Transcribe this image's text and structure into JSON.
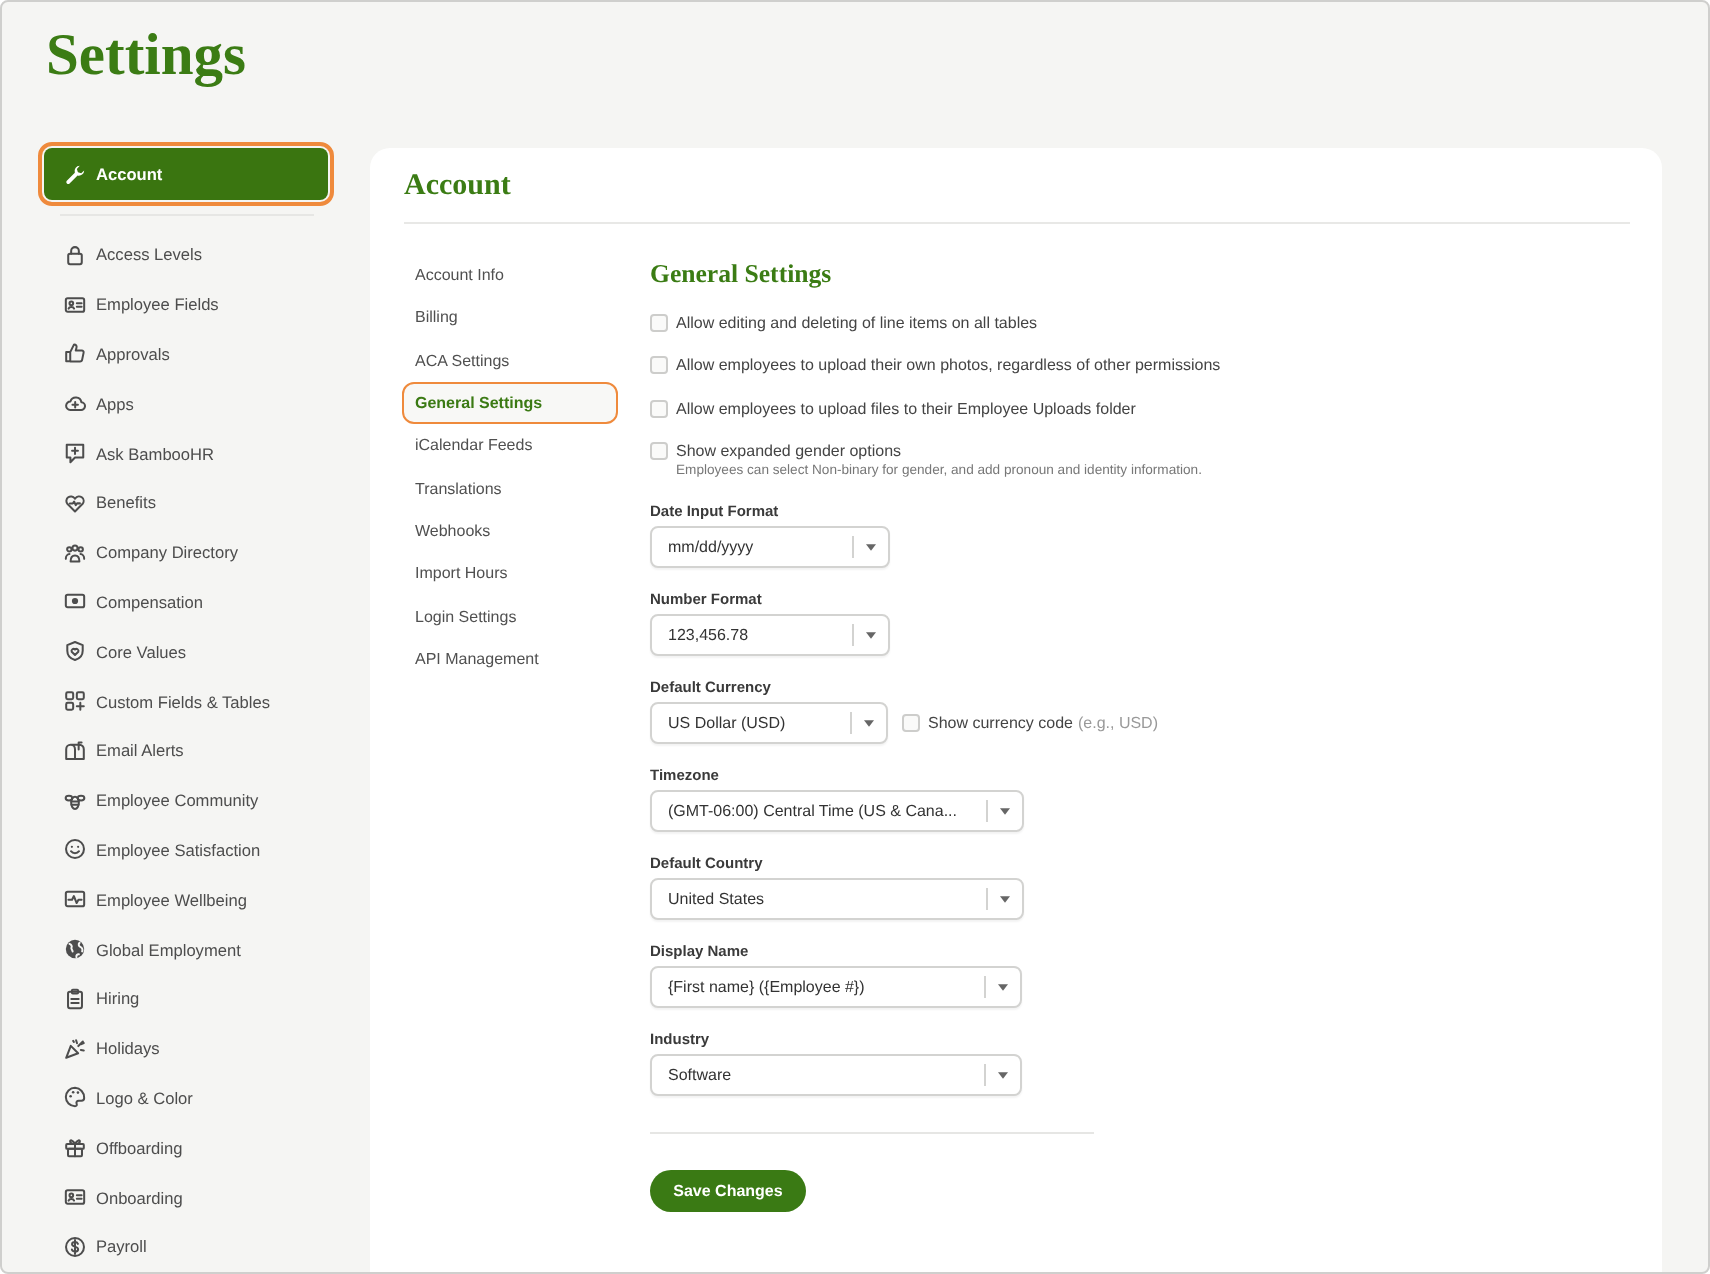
{
  "page": {
    "title": "Settings"
  },
  "sidebar": {
    "items": [
      {
        "label": "Account",
        "selected": true
      },
      {
        "label": "Access Levels",
        "selected": false
      },
      {
        "label": "Employee Fields",
        "selected": false
      },
      {
        "label": "Approvals",
        "selected": false
      },
      {
        "label": "Apps",
        "selected": false
      },
      {
        "label": "Ask BambooHR",
        "selected": false
      },
      {
        "label": "Benefits",
        "selected": false
      },
      {
        "label": "Company Directory",
        "selected": false
      },
      {
        "label": "Compensation",
        "selected": false
      },
      {
        "label": "Core Values",
        "selected": false
      },
      {
        "label": "Custom Fields & Tables",
        "selected": false
      },
      {
        "label": "Email Alerts",
        "selected": false
      },
      {
        "label": "Employee Community",
        "selected": false
      },
      {
        "label": "Employee Satisfaction",
        "selected": false
      },
      {
        "label": "Employee Wellbeing",
        "selected": false
      },
      {
        "label": "Global Employment",
        "selected": false
      },
      {
        "label": "Hiring",
        "selected": false
      },
      {
        "label": "Holidays",
        "selected": false
      },
      {
        "label": "Logo & Color",
        "selected": false
      },
      {
        "label": "Offboarding",
        "selected": false
      },
      {
        "label": "Onboarding",
        "selected": false
      },
      {
        "label": "Payroll",
        "selected": false
      }
    ]
  },
  "panel": {
    "title": "Account",
    "subnav": {
      "items": [
        {
          "label": "Account Info",
          "selected": false
        },
        {
          "label": "Billing",
          "selected": false
        },
        {
          "label": "ACA Settings",
          "selected": false
        },
        {
          "label": "General Settings",
          "selected": true
        },
        {
          "label": "iCalendar Feeds",
          "selected": false
        },
        {
          "label": "Translations",
          "selected": false
        },
        {
          "label": "Webhooks",
          "selected": false
        },
        {
          "label": "Import Hours",
          "selected": false
        },
        {
          "label": "Login Settings",
          "selected": false
        },
        {
          "label": "API Management",
          "selected": false
        }
      ]
    },
    "general_settings": {
      "title": "General Settings",
      "options": [
        {
          "label": "Allow editing and deleting of line items on all tables",
          "checked": false
        },
        {
          "label": "Allow employees to upload their own photos, regardless of other permissions",
          "checked": false
        },
        {
          "label": "Allow employees to upload files to their Employee Uploads folder",
          "checked": false
        },
        {
          "label": "Show expanded gender options",
          "checked": false,
          "description": "Employees can select Non-binary for gender, and add pronoun and identity information."
        }
      ],
      "fields": [
        {
          "label": "Date Input Format",
          "value": "mm/dd/yyyy"
        },
        {
          "label": "Number Format",
          "value": "123,456.78"
        },
        {
          "label": "Default Currency",
          "value": "US Dollar (USD)",
          "option": {
            "label": "Show currency code",
            "hint": "(e.g., USD)",
            "checked": false
          }
        },
        {
          "label": "Timezone",
          "value": "(GMT-06:00) Central Time (US & Cana..."
        },
        {
          "label": "Default Country",
          "value": "United States"
        },
        {
          "label": "Display Name",
          "value": "{First name} ({Employee #})"
        },
        {
          "label": "Industry",
          "value": "Software"
        }
      ],
      "save_button": "Save Changes"
    }
  }
}
